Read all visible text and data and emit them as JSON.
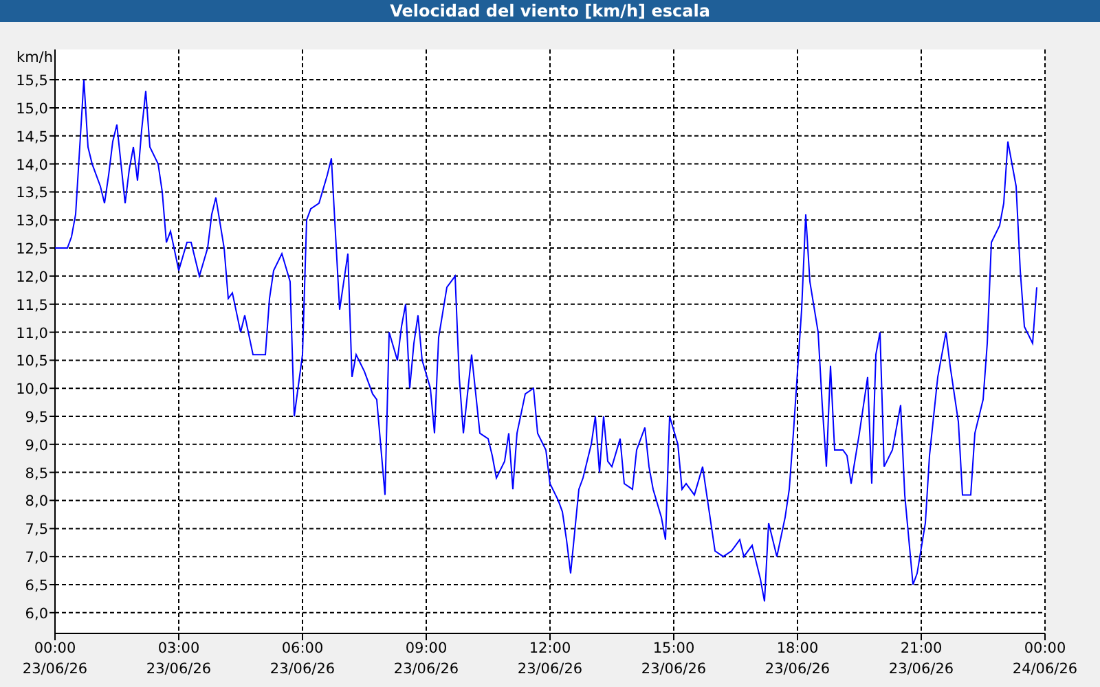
{
  "window": {
    "title": "Velocidad del viento [km/h] escala"
  },
  "chart": {
    "chart_data": {
      "type": "line",
      "ylabel": "km/h",
      "xlim": [
        0,
        24
      ],
      "ylim": [
        5.63,
        16.04
      ],
      "grid": true,
      "xticks": [
        {
          "value": 0,
          "label": "00:00"
        },
        {
          "value": 3,
          "label": "03:00"
        },
        {
          "value": 6,
          "label": "06:00"
        },
        {
          "value": 9,
          "label": "09:00"
        },
        {
          "value": 12,
          "label": "12:00"
        },
        {
          "value": 15,
          "label": "15:00"
        },
        {
          "value": 18,
          "label": "18:00"
        },
        {
          "value": 21,
          "label": "21:00"
        },
        {
          "value": 24,
          "label": "00:00"
        }
      ],
      "annotations": [
        "23/06/26",
        "23/06/26",
        "23/06/26",
        "23/06/26",
        "23/06/26",
        "23/06/26",
        "23/06/26",
        "23/06/26",
        "24/06/26"
      ],
      "yticks": [
        {
          "value": 6,
          "label": "6,0"
        },
        {
          "value": 6.5,
          "label": "6,5"
        },
        {
          "value": 7,
          "label": "7,0"
        },
        {
          "value": 7.5,
          "label": "7,5"
        },
        {
          "value": 8,
          "label": "8,0"
        },
        {
          "value": 8.5,
          "label": "8,5"
        },
        {
          "value": 9,
          "label": "9,0"
        },
        {
          "value": 9.5,
          "label": "9,5"
        },
        {
          "value": 10,
          "label": "10,0"
        },
        {
          "value": 10.5,
          "label": "10,5"
        },
        {
          "value": 11,
          "label": "11,0"
        },
        {
          "value": 11.5,
          "label": "11,5"
        },
        {
          "value": 12,
          "label": "12,0"
        },
        {
          "value": 12.5,
          "label": "12,5"
        },
        {
          "value": 13,
          "label": "13,0"
        },
        {
          "value": 13.5,
          "label": "13,5"
        },
        {
          "value": 14,
          "label": "14,0"
        },
        {
          "value": 14.5,
          "label": "14,5"
        },
        {
          "value": 15,
          "label": "15,0"
        },
        {
          "value": 15.5,
          "label": "15,5"
        }
      ],
      "x": [
        0,
        0.3,
        0.4,
        0.5,
        0.7,
        0.8,
        0.9,
        1.1,
        1.2,
        1.3,
        1.4,
        1.5,
        1.7,
        1.8,
        1.9,
        2.0,
        2.1,
        2.2,
        2.3,
        2.5,
        2.6,
        2.7,
        2.8,
        3.0,
        3.2,
        3.3,
        3.5,
        3.7,
        3.8,
        3.9,
        4.1,
        4.2,
        4.3,
        4.5,
        4.6,
        4.8,
        4.9,
        5.1,
        5.2,
        5.3,
        5.5,
        5.7,
        5.8,
        6.0,
        6.1,
        6.2,
        6.4,
        6.6,
        6.7,
        6.9,
        7.1,
        7.2,
        7.3,
        7.5,
        7.7,
        7.8,
        8.0,
        8.1,
        8.3,
        8.4,
        8.5,
        8.6,
        8.7,
        8.8,
        8.9,
        9.1,
        9.2,
        9.3,
        9.5,
        9.7,
        9.8,
        9.9,
        10.1,
        10.2,
        10.3,
        10.5,
        10.6,
        10.7,
        10.9,
        11.0,
        11.1,
        11.2,
        11.4,
        11.6,
        11.7,
        11.9,
        12.0,
        12.2,
        12.3,
        12.4,
        12.5,
        12.7,
        12.8,
        13.0,
        13.1,
        13.2,
        13.3,
        13.4,
        13.5,
        13.7,
        13.8,
        14.0,
        14.1,
        14.3,
        14.4,
        14.5,
        14.7,
        14.8,
        14.9,
        15.1,
        15.2,
        15.3,
        15.5,
        15.7,
        15.8,
        15.9,
        16.0,
        16.2,
        16.4,
        16.6,
        16.7,
        16.9,
        17.1,
        17.2,
        17.3,
        17.5,
        17.7,
        17.8,
        17.9,
        18.1,
        18.2,
        18.3,
        18.5,
        18.6,
        18.7,
        18.8,
        18.9,
        19.1,
        19.2,
        19.3,
        19.5,
        19.7,
        19.8,
        19.9,
        20.0,
        20.1,
        20.3,
        20.5,
        20.6,
        20.8,
        20.9,
        21.1,
        21.2,
        21.4,
        21.6,
        21.7,
        21.9,
        22.0,
        22.2,
        22.3,
        22.5,
        22.6,
        22.7,
        22.9,
        23.0,
        23.1,
        23.3,
        23.4,
        23.5,
        23.7,
        23.8
      ],
      "series": [
        {
          "color": "#0000ff",
          "values": [
            12.5,
            12.5,
            12.7,
            13.1,
            15.5,
            14.3,
            14.0,
            13.6,
            13.3,
            13.8,
            14.4,
            14.7,
            13.3,
            13.9,
            14.3,
            13.7,
            14.6,
            15.3,
            14.3,
            14.0,
            13.5,
            12.6,
            12.8,
            12.1,
            12.6,
            12.6,
            12.0,
            12.5,
            13.1,
            13.4,
            12.5,
            11.6,
            11.7,
            11.0,
            11.3,
            10.6,
            10.6,
            10.6,
            11.6,
            12.1,
            12.4,
            11.9,
            9.5,
            10.6,
            13.0,
            13.2,
            13.3,
            13.8,
            14.1,
            11.4,
            12.4,
            10.2,
            10.6,
            10.3,
            9.9,
            9.8,
            8.1,
            11.0,
            10.5,
            11.1,
            11.5,
            10.0,
            10.8,
            11.3,
            10.5,
            10.0,
            9.2,
            10.9,
            11.8,
            12.0,
            10.2,
            9.2,
            10.6,
            9.9,
            9.2,
            9.1,
            8.8,
            8.4,
            8.7,
            9.2,
            8.2,
            9.2,
            9.9,
            10.0,
            9.2,
            8.9,
            8.3,
            8.0,
            7.8,
            7.3,
            6.7,
            8.2,
            8.4,
            9.0,
            9.5,
            8.5,
            9.5,
            8.7,
            8.6,
            9.1,
            8.3,
            8.2,
            8.9,
            9.3,
            8.6,
            8.2,
            7.7,
            7.3,
            9.5,
            9.0,
            8.2,
            8.3,
            8.1,
            8.6,
            8.1,
            7.6,
            7.1,
            7.0,
            7.1,
            7.3,
            7.0,
            7.2,
            6.6,
            6.2,
            7.6,
            7.0,
            7.7,
            8.2,
            9.2,
            11.4,
            13.1,
            11.9,
            11.0,
            9.7,
            8.6,
            10.4,
            8.9,
            8.9,
            8.8,
            8.3,
            9.2,
            10.2,
            8.3,
            10.6,
            11.0,
            8.6,
            8.9,
            9.7,
            8.1,
            6.5,
            6.7,
            7.6,
            8.8,
            10.2,
            11.0,
            10.4,
            9.4,
            8.1,
            8.1,
            9.2,
            9.8,
            10.8,
            12.6,
            12.9,
            13.3,
            14.4,
            13.6,
            12.1,
            11.1,
            10.8,
            11.8
          ]
        }
      ]
    }
  }
}
